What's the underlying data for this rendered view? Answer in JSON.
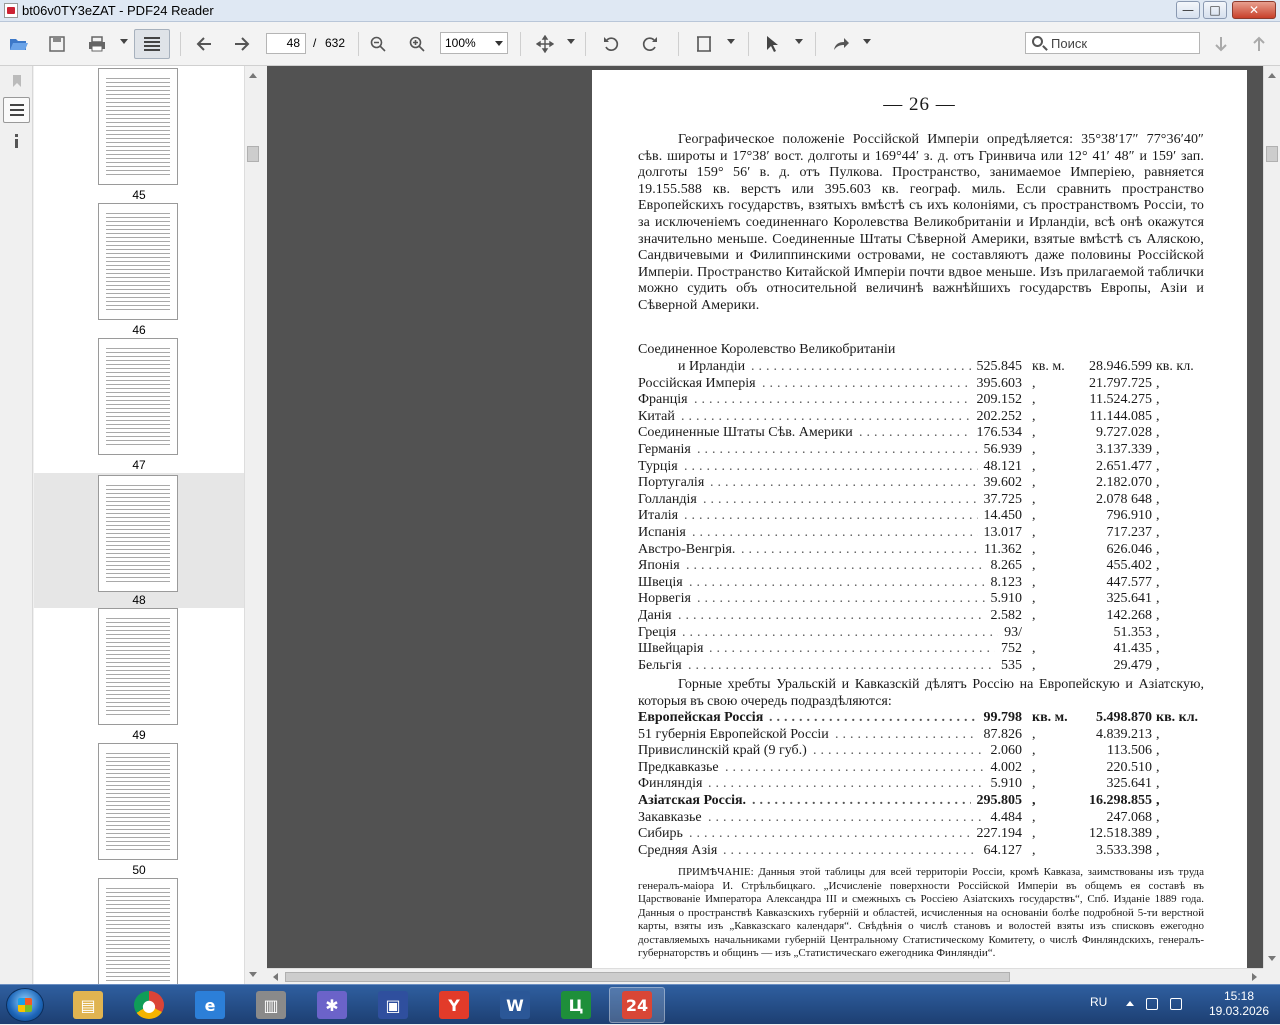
{
  "window": {
    "title": "bt06v0TY3eZAT - PDF24 Reader",
    "minimize": "—",
    "maximize": "□",
    "close": "✕"
  },
  "toolbar": {
    "page_current": "48",
    "page_separator": "/",
    "page_total": "632",
    "zoom": "100%",
    "search_placeholder": "Поиск"
  },
  "thumbnails": [
    {
      "label": "45",
      "selected": false
    },
    {
      "label": "46",
      "selected": false
    },
    {
      "label": "47",
      "selected": false
    },
    {
      "label": "48",
      "selected": true
    },
    {
      "label": "49",
      "selected": false
    },
    {
      "label": "50",
      "selected": false
    },
    {
      "label": "",
      "selected": false
    }
  ],
  "document": {
    "page_number": "— 26 —",
    "intro": "Географическое положеніе Россійской Имперіи опредѣляется: 35°38′17″ 77°36′40″ сѣв. широты и 17°38′ вост. долготы и 169°44′ з. д. отъ Гринвича или 12° 41′ 48″ и 159′ зап. долготы 159° 56′ в. д. отъ Пулкова. Пространство, занимаемое Имперіею, равняется 19.155.588 кв. верстъ или 395.603 кв. географ. миль. Если сравнить пространство Европейскихъ государствъ, взятыхъ вмѣстѣ съ ихъ колоніями, съ пространствомъ Россіи, то за исключеніемъ соединеннаго Королевства Великобританіи и Ирландіи, всѣ онѣ окажутся значительно меньше. Соединенные Штаты Сѣверной Америки, взятые вмѣстѣ съ Аляскою, Сандвичевыми и Филиппинскими островами, не составляютъ даже половины Россійской Имперіи. Пространство Китайской Имперіи почти вдвое меньше. Изъ прилагаемой таблички можно судить объ относительной величинѣ важнѣйшихъ государствъ Европы, Азіи и Сѣверной Америки.",
    "table1_head": "Соединенное Королевство Великобританіи",
    "table1": [
      {
        "name": "и Ирландіи",
        "a": "525.845",
        "u1": "кв. м.",
        "b": "28.946.599",
        "u2": "кв. кл."
      },
      {
        "name": "Россійская Имперія",
        "a": "395.603",
        "u1": ",",
        "b": "21.797.725",
        "u2": ","
      },
      {
        "name": "Франція",
        "a": "209.152",
        "u1": ",",
        "b": "11.524.275",
        "u2": ","
      },
      {
        "name": "Китай",
        "a": "202.252",
        "u1": ",",
        "b": "11.144.085",
        "u2": ","
      },
      {
        "name": "Соединенные Штаты Сѣв. Америки",
        "a": "176.534",
        "u1": ",",
        "b": "9.727.028",
        "u2": ","
      },
      {
        "name": "Германія",
        "a": "56.939",
        "u1": ",",
        "b": "3.137.339",
        "u2": ","
      },
      {
        "name": "Турція",
        "a": "48.121",
        "u1": ",",
        "b": "2.651.477",
        "u2": ","
      },
      {
        "name": "Португалія",
        "a": "39.602",
        "u1": ",",
        "b": "2.182.070",
        "u2": ","
      },
      {
        "name": "Голландія",
        "a": "37.725",
        "u1": ",",
        "b": "2.078 648",
        "u2": ","
      },
      {
        "name": "Италія",
        "a": "14.450",
        "u1": ",",
        "b": "796.910",
        "u2": ","
      },
      {
        "name": "Испанія",
        "a": "13.017",
        "u1": ",",
        "b": "717.237",
        "u2": ","
      },
      {
        "name": "Австро-Венгрія.",
        "a": "11.362",
        "u1": ",",
        "b": "626.046",
        "u2": ","
      },
      {
        "name": "Японія",
        "a": "8.265",
        "u1": ",",
        "b": "455.402",
        "u2": ","
      },
      {
        "name": "Швеція",
        "a": "8.123",
        "u1": ",",
        "b": "447.577",
        "u2": ","
      },
      {
        "name": "Норвегія",
        "a": "5.910",
        "u1": ",",
        "b": "325.641",
        "u2": ","
      },
      {
        "name": "Данія",
        "a": "2.582",
        "u1": ",",
        "b": "142.268",
        "u2": ","
      },
      {
        "name": "Греція",
        "a": "93/",
        "u1": "",
        "b": "51.353",
        "u2": ","
      },
      {
        "name": "Швейцарія",
        "a": "752",
        "u1": ",",
        "b": "41.435",
        "u2": ","
      },
      {
        "name": "Бельгія",
        "a": "535",
        "u1": ",",
        "b": "29.479",
        "u2": ","
      }
    ],
    "para2": "Горные хребты Уральскій и Кавказскій дѣлятъ Россію на Европейскую и Азіатскую, которыя въ свою очередь подраздѣляются:",
    "table2": [
      {
        "name": "Европейская Россія",
        "a": "99.798",
        "u1": "кв. м.",
        "b": "5.498.870",
        "u2": "кв. кл.",
        "bold": true
      },
      {
        "name": "51 губернія Европейской Россіи",
        "a": "87.826",
        "u1": ",",
        "b": "4.839.213",
        "u2": ",",
        "bold": false
      },
      {
        "name": "Привислинскій край (9 губ.)",
        "a": "2.060",
        "u1": ",",
        "b": "113.506",
        "u2": ",",
        "bold": false
      },
      {
        "name": "Предкавказье",
        "a": "4.002",
        "u1": ",",
        "b": "220.510",
        "u2": ",",
        "bold": false
      },
      {
        "name": "Финляндія",
        "a": "5.910",
        "u1": ",",
        "b": "325.641",
        "u2": ",",
        "bold": false
      },
      {
        "name": "Азіатская Россія.",
        "a": "295.805",
        "u1": ",",
        "b": "16.298.855",
        "u2": ",",
        "bold": true
      },
      {
        "name": "Закавказье",
        "a": "4.484",
        "u1": ",",
        "b": "247.068",
        "u2": ",",
        "bold": false
      },
      {
        "name": "Сибирь",
        "a": "227.194",
        "u1": ",",
        "b": "12.518.389",
        "u2": ",",
        "bold": false
      },
      {
        "name": "Средняя Азія",
        "a": "64.127",
        "u1": ",",
        "b": "3.533.398",
        "u2": ",",
        "bold": false
      }
    ],
    "note": "ПРИМѢЧАНІЕ: Данныя этой таблицы для всей территоріи Россіи, кромѣ Кавказа, заимствованы изъ труда генералъ-маіора И. Стрѣльбицкаго. „Исчисленіе поверхности Россійской Имперіи въ общемъ ея составѣ въ Царствованіе Императора Александра III и смежныхъ съ Россіею Азіатскихъ государствъ“, Спб. Изданіе 1889 года. Данныя о пространствѣ Кавказскихъ губерній и областей, исчисленныя на основаніи болѣе подробной 5-ти верстной карты, взяты изъ „Кавказскаго календаря“. Свѣдѣнія о числѣ становъ и волостей взяты изъ списковъ ежегодно доставляемыхъ начальниками губерній Центральному Статистическому Комитету, о числѣ Финляндскихъ, генералъ-губернаторствъ и общинъ — изъ „Статистическаго ежегодника Финляндіи“."
  },
  "taskbar": {
    "lang": "RU",
    "time": "15:18",
    "date": "19.03.2026",
    "apps": [
      {
        "name": "explorer",
        "color": "#e0b451"
      },
      {
        "name": "chrome",
        "color": "#3a8ee6"
      },
      {
        "name": "internet-explorer",
        "color": "#2c7fd8"
      },
      {
        "name": "printer",
        "color": "#8a8a8a"
      },
      {
        "name": "spider-app",
        "color": "#6b63c9"
      },
      {
        "name": "floppy-save",
        "color": "#2f4f9e"
      },
      {
        "name": "yandex-browser",
        "color": "#e23b2a"
      },
      {
        "name": "word",
        "color": "#2b5797"
      },
      {
        "name": "calc-app",
        "color": "#1e8f3a"
      },
      {
        "name": "pdf24",
        "color": "#d94636"
      }
    ]
  },
  "colors": {
    "viewer_bg": "#525252",
    "titlebar": "#dfe8f3",
    "taskbar": "#2a4e8a"
  }
}
